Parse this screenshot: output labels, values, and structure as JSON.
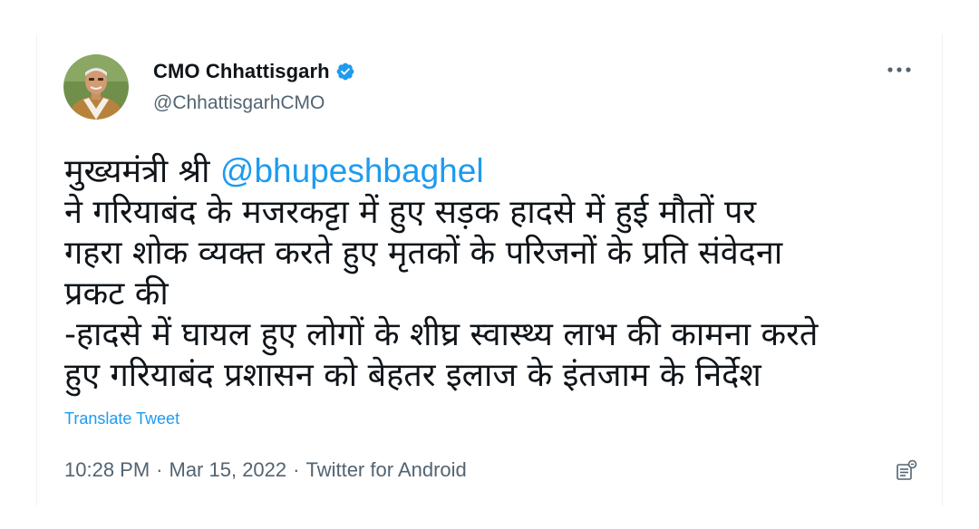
{
  "author": {
    "display_name": "CMO Chhattisgarh",
    "handle": "@ChhattisgarhCMO",
    "verified": true
  },
  "tweet": {
    "line1_prefix": "मुख्यमंत्री श्री ",
    "mention": "@bhupeshbaghel",
    "line2": "ने गरियाबंद के मजरकट्टा में हुए सड़क हादसे में हुई मौतों पर",
    "line3": "गहरा शोक व्यक्त करते हुए मृतकों के परिजनों के प्रति संवेदना",
    "line4": "प्रकट की",
    "line5": "-हादसे में घायल हुए लोगों के शीघ्र स्वास्थ्य लाभ की कामना करते",
    "line6": "हुए गरियाबंद प्रशासन को बेहतर इलाज के इंतजाम के निर्देश"
  },
  "translate_label": "Translate Tweet",
  "meta": {
    "time": "10:28 PM",
    "separator": "·",
    "date": "Mar 15, 2022",
    "source": "Twitter for Android"
  },
  "icons": {
    "verified": "verified-badge-icon",
    "more": "more-options-icon",
    "analytics": "tweet-analytics-icon"
  },
  "colors": {
    "link": "#1d9bf0",
    "text": "#0f1419",
    "secondary": "#536471"
  }
}
